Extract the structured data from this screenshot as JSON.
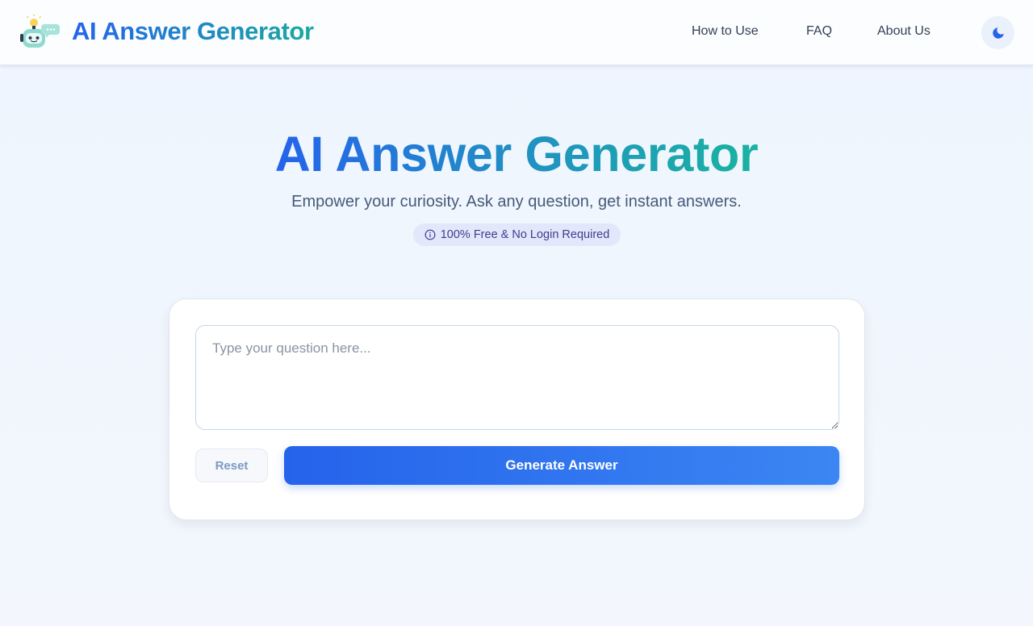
{
  "header": {
    "brand": "AI Answer Generator",
    "logo_icon": "robot-chat-icon",
    "nav": [
      {
        "label": "How to Use"
      },
      {
        "label": "FAQ"
      },
      {
        "label": "About Us"
      }
    ],
    "theme_toggle_icon": "moon-icon"
  },
  "hero": {
    "title": "AI Answer Generator",
    "subtitle": "Empower your curiosity. Ask any question, get instant answers.",
    "badge_icon": "info-icon",
    "badge": "100% Free & No Login Required"
  },
  "form": {
    "question_placeholder": "Type your question here...",
    "question_value": "",
    "reset_label": "Reset",
    "generate_label": "Generate Answer"
  },
  "colors": {
    "primary": "#2563eb",
    "accent_teal": "#1ab3a0",
    "badge_bg": "#e3e7fb",
    "page_bg": "#eef5fe"
  }
}
